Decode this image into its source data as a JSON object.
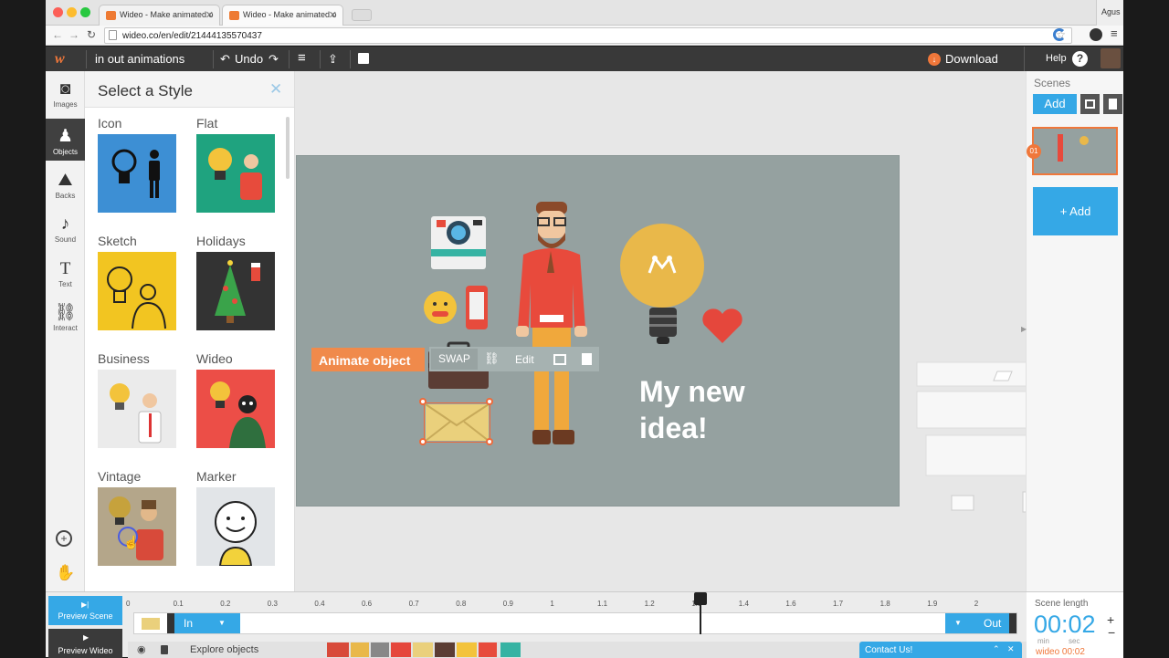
{
  "browser": {
    "tabs": [
      {
        "title": "Wideo - Make animated o"
      },
      {
        "title": "Wideo - Make animated o"
      }
    ],
    "user": "Agus",
    "url": "wideo.co/en/edit/21444135570437"
  },
  "toolbar": {
    "project_name": "in out animations",
    "undo_label": "Undo",
    "download_label": "Download",
    "help_label": "Help"
  },
  "rail": {
    "items": [
      {
        "label": "Images",
        "icon": "camera-icon"
      },
      {
        "label": "Objects",
        "icon": "person-icon"
      },
      {
        "label": "Backs",
        "icon": "mountain-icon"
      },
      {
        "label": "Sound",
        "icon": "music-note-icon"
      },
      {
        "label": "Text",
        "icon": "text-icon"
      },
      {
        "label": "Interact",
        "icon": "link-icon"
      }
    ]
  },
  "style_panel": {
    "title": "Select a Style",
    "styles": [
      {
        "label": "Icon"
      },
      {
        "label": "Flat"
      },
      {
        "label": "Sketch"
      },
      {
        "label": "Holidays"
      },
      {
        "label": "Business"
      },
      {
        "label": "Wideo"
      },
      {
        "label": "Vintage"
      },
      {
        "label": "Marker"
      }
    ]
  },
  "canvas": {
    "headline_line1": "My new",
    "headline_line2": "idea!",
    "background_color": "#95a1a0"
  },
  "object_toolbar": {
    "animate_label": "Animate object",
    "swap_label": "SWAP",
    "edit_label": "Edit"
  },
  "scenes": {
    "title": "Scenes",
    "add_label": "Add",
    "scene_number": "01",
    "add_scene_label": "+ Add"
  },
  "timeline": {
    "preview_scene": "Preview Scene",
    "preview_wideo": "Preview Wideo",
    "ticks": [
      "0",
      "0.1",
      "0.2",
      "0.3",
      "0.4",
      "0.6",
      "0.7",
      "0.8",
      "0.9",
      "1",
      "1.1",
      "1.2",
      "1.3",
      "1.4",
      "1.6",
      "1.7",
      "1.8",
      "1.9",
      "2"
    ],
    "in_label": "In",
    "out_label": "Out",
    "explore_label": "Explore objects",
    "scene_length_label": "Scene length",
    "scene_length_value": "00:02",
    "min_label": "min",
    "sec_label": "sec",
    "wideo_length": "wideo 00:02",
    "contact_label": "Contact Us!"
  },
  "colors": {
    "accent_orange": "#f0773a",
    "accent_blue": "#35a8e6",
    "dark_toolbar": "#393939"
  }
}
